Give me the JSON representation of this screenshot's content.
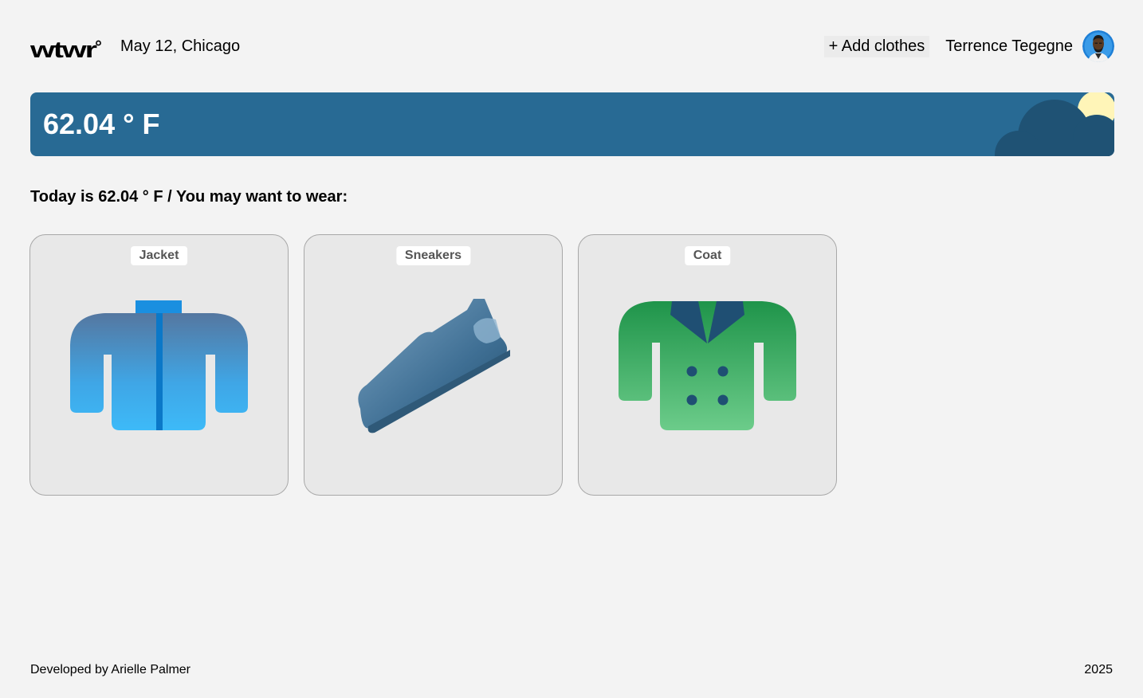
{
  "header": {
    "logo_text": "wtwr°",
    "date_location": "May 12, Chicago",
    "add_clothes_label": "+ Add clothes",
    "username": "Terrence Tegegne",
    "avatar_icon": "user-avatar"
  },
  "weather": {
    "temperature": "62.04 ° F",
    "condition_icon": "sun-behind-cloud-icon",
    "colors": {
      "banner": "#286a94",
      "cloud": "#1f5274",
      "sun": "#fff5b8"
    }
  },
  "recommendation": "Today is 62.04 ° F / You may want to wear:",
  "items": [
    {
      "name": "Jacket",
      "icon": "jacket-icon"
    },
    {
      "name": "Sneakers",
      "icon": "sneaker-icon"
    },
    {
      "name": "Coat",
      "icon": "coat-icon"
    }
  ],
  "footer": {
    "credit": "Developed by Arielle Palmer",
    "year": "2025"
  }
}
